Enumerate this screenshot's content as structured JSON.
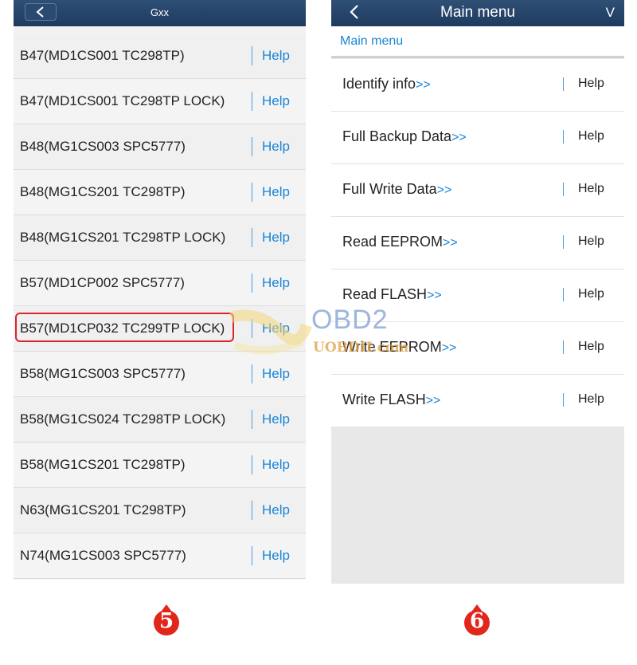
{
  "left_screen": {
    "title": "Gxx",
    "rows": [
      {
        "label": "B47(MD1CS001 TC298TP)",
        "help": "Help"
      },
      {
        "label": "B47(MD1CS001 TC298TP LOCK)",
        "help": "Help"
      },
      {
        "label": "B48(MG1CS003 SPC5777)",
        "help": "Help"
      },
      {
        "label": "B48(MG1CS201 TC298TP)",
        "help": "Help"
      },
      {
        "label": "B48(MG1CS201 TC298TP LOCK)",
        "help": "Help"
      },
      {
        "label": "B57(MD1CP002 SPC5777)",
        "help": "Help"
      },
      {
        "label": "B57(MD1CP032 TC299TP LOCK)",
        "help": "Help"
      },
      {
        "label": "B58(MG1CS003 SPC5777)",
        "help": "Help"
      },
      {
        "label": "B58(MG1CS024 TC298TP LOCK)",
        "help": "Help"
      },
      {
        "label": "B58(MG1CS201 TC298TP)",
        "help": "Help"
      },
      {
        "label": "N63(MG1CS201 TC298TP)",
        "help": "Help"
      },
      {
        "label": "N74(MG1CS003 SPC5777)",
        "help": "Help"
      }
    ],
    "highlighted_index": 6,
    "step_number": "5"
  },
  "right_screen": {
    "title": "Main menu",
    "version_label": "V",
    "breadcrumb": "Main menu",
    "items": [
      {
        "label": "Identify info",
        "arrows": ">>",
        "help": "Help"
      },
      {
        "label": "Full Backup Data",
        "arrows": ">>",
        "help": "Help"
      },
      {
        "label": "Full Write Data",
        "arrows": ">>",
        "help": "Help"
      },
      {
        "label": "Read EEPROM",
        "arrows": ">>",
        "help": "Help"
      },
      {
        "label": "Read FLASH",
        "arrows": ">>",
        "help": "Help"
      },
      {
        "label": "Write EEPROM",
        "arrows": ">>",
        "help": "Help"
      },
      {
        "label": "Write FLASH",
        "arrows": ">>",
        "help": "Help"
      }
    ],
    "step_number": "6"
  },
  "watermark": {
    "main": "OBD2",
    "sub": "UOBDII.com"
  },
  "colors": {
    "titlebar": "#1e3a5f",
    "accent": "#1a85d8",
    "highlight": "#d9252b",
    "badge": "#e1261c"
  },
  "icons": {
    "back": "chevron-left-icon"
  }
}
